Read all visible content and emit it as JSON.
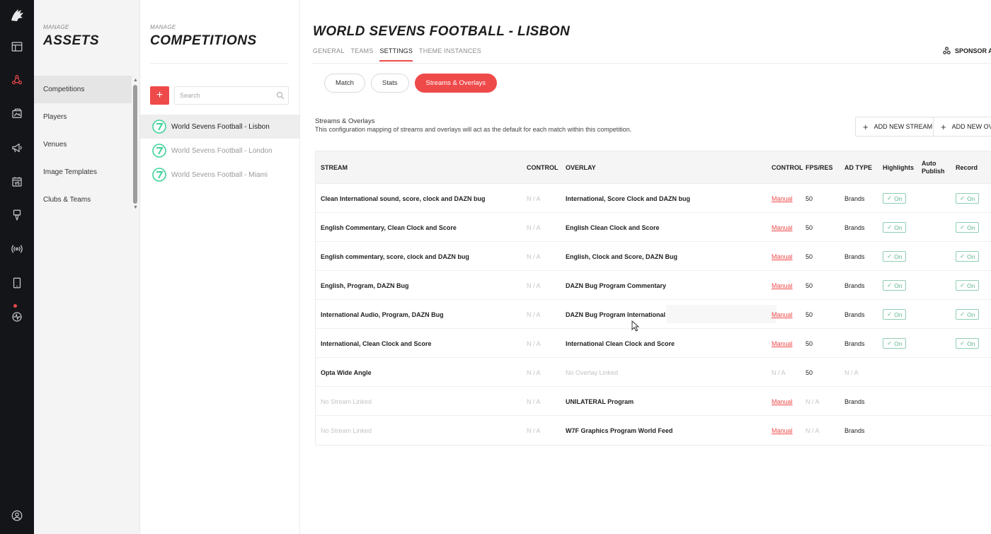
{
  "rail": {
    "icons": [
      "logo-icon",
      "layout-icon",
      "assets-icon",
      "media-icon",
      "megaphone-icon",
      "fixtures-icon",
      "brush-icon",
      "broadcast-icon",
      "tablet-icon",
      "activity-icon",
      "user-icon"
    ]
  },
  "assets": {
    "manage_label": "MANAGE",
    "title": "ASSETS",
    "items": [
      "Competitions",
      "Players",
      "Venues",
      "Image Templates",
      "Clubs & Teams"
    ],
    "scroll_up": "▲",
    "scroll_down": "▼"
  },
  "competitions": {
    "manage_label": "MANAGE",
    "title": "COMPETITIONS",
    "add_label": "+",
    "search_placeholder": "Search",
    "items": [
      "World Sevens Football - Lisbon",
      "World Sevens Football - London",
      "World Sevens Football - Miami"
    ]
  },
  "main": {
    "title": "WORLD SEVENS FOOTBALL - LISBON",
    "tabs": [
      "GENERAL",
      "TEAMS",
      "SETTINGS",
      "THEME INSTANCES"
    ],
    "sponsor_label": "SPONSOR ALI",
    "pills": [
      "Match",
      "Stats",
      "Streams & Overlays"
    ],
    "section_title": "Streams & Overlays",
    "section_desc": "This configuration mapping of streams and overlays will act as the default for each match within this competition.",
    "add_stream": "ADD NEW STREAM",
    "add_overlay": "ADD NEW OVER",
    "plus": "+"
  },
  "table": {
    "headers": {
      "stream": "STREAM",
      "control1": "CONTROL",
      "overlay": "OVERLAY",
      "control2": "CONTROL",
      "fps": "FPS/RES",
      "ad": "AD TYPE",
      "highlights": "Highlights",
      "autopublish": "Auto Publish",
      "record": "Record"
    },
    "toggle_label": "On",
    "rows": [
      {
        "stream": "Clean International sound, score, clock and DAZN bug",
        "c1": "N / A",
        "overlay": "International, Score Clock and DAZN bug",
        "c2": "Manual",
        "fps": "50",
        "ad": "Brands",
        "hl": "On",
        "rec": "On"
      },
      {
        "stream": "English Commentary, Clean Clock and Score",
        "c1": "N / A",
        "overlay": "English Clean Clock and Score",
        "c2": "Manual",
        "fps": "50",
        "ad": "Brands",
        "hl": "On",
        "rec": "On"
      },
      {
        "stream": "English commentary, score, clock and DAZN bug",
        "c1": "N / A",
        "overlay": "English, Clock and Score, DAZN Bug",
        "c2": "Manual",
        "fps": "50",
        "ad": "Brands",
        "hl": "On",
        "rec": "On"
      },
      {
        "stream": "English, Program, DAZN Bug",
        "c1": "N / A",
        "overlay": "DAZN Bug Program Commentary",
        "c2": "Manual",
        "fps": "50",
        "ad": "Brands",
        "hl": "On",
        "rec": "On"
      },
      {
        "stream": "International Audio, Program, DAZN Bug",
        "c1": "N / A",
        "overlay": "DAZN Bug Program International",
        "c2": "Manual",
        "fps": "50",
        "ad": "Brands",
        "hl": "On",
        "rec": "On"
      },
      {
        "stream": "International, Clean Clock and Score",
        "c1": "N / A",
        "overlay": "International Clean Clock and Score",
        "c2": "Manual",
        "fps": "50",
        "ad": "Brands",
        "hl": "On",
        "rec": "On"
      },
      {
        "stream": "Opta Wide Angle",
        "c1": "N / A",
        "overlay": "No Overlay Linked",
        "c2": "N / A",
        "fps": "50",
        "ad": "N / A",
        "hl": "",
        "rec": ""
      },
      {
        "stream": "No Stream Linked",
        "c1": "N / A",
        "overlay": "UNILATERAL Program",
        "c2": "Manual",
        "fps": "N / A",
        "ad": "Brands",
        "hl": "",
        "rec": ""
      },
      {
        "stream": "No Stream Linked",
        "c1": "N / A",
        "overlay": "W7F Graphics Program World Feed",
        "c2": "Manual",
        "fps": "N / A",
        "ad": "Brands",
        "hl": "",
        "rec": ""
      }
    ]
  }
}
